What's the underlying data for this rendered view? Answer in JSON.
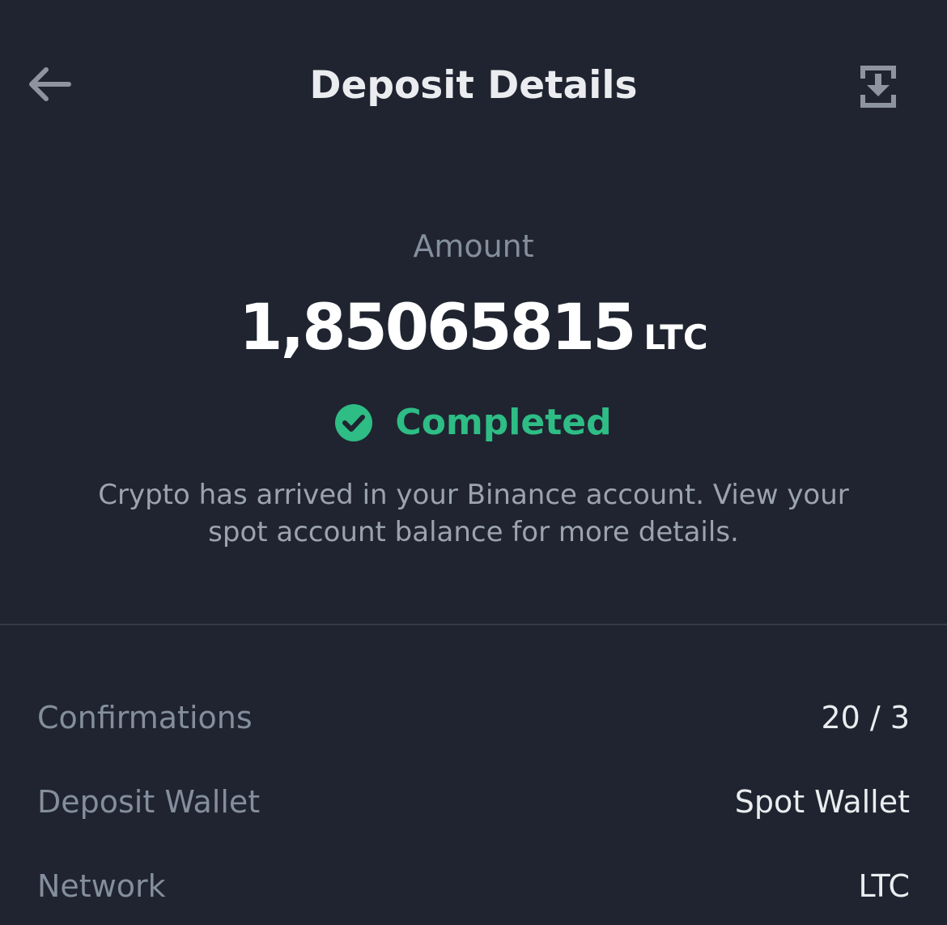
{
  "header": {
    "title": "Deposit Details",
    "back_icon": "arrow-left-icon",
    "download_icon": "download-icon"
  },
  "amount": {
    "label": "Amount",
    "value": "1,85065815",
    "unit": "LTC"
  },
  "status": {
    "icon": "check-circle-icon",
    "text": "Completed",
    "color": "#2ebd85"
  },
  "note": "Crypto has arrived in your Binance account. View your spot account balance for more details.",
  "details": [
    {
      "label": "Confirmations",
      "value": "20 / 3"
    },
    {
      "label": "Deposit Wallet",
      "value": "Spot Wallet"
    },
    {
      "label": "Network",
      "value": "LTC"
    }
  ],
  "colors": {
    "background": "#1f2430",
    "primary_text": "#eaecef",
    "secondary_text": "#848e9c",
    "success": "#2ebd85"
  }
}
